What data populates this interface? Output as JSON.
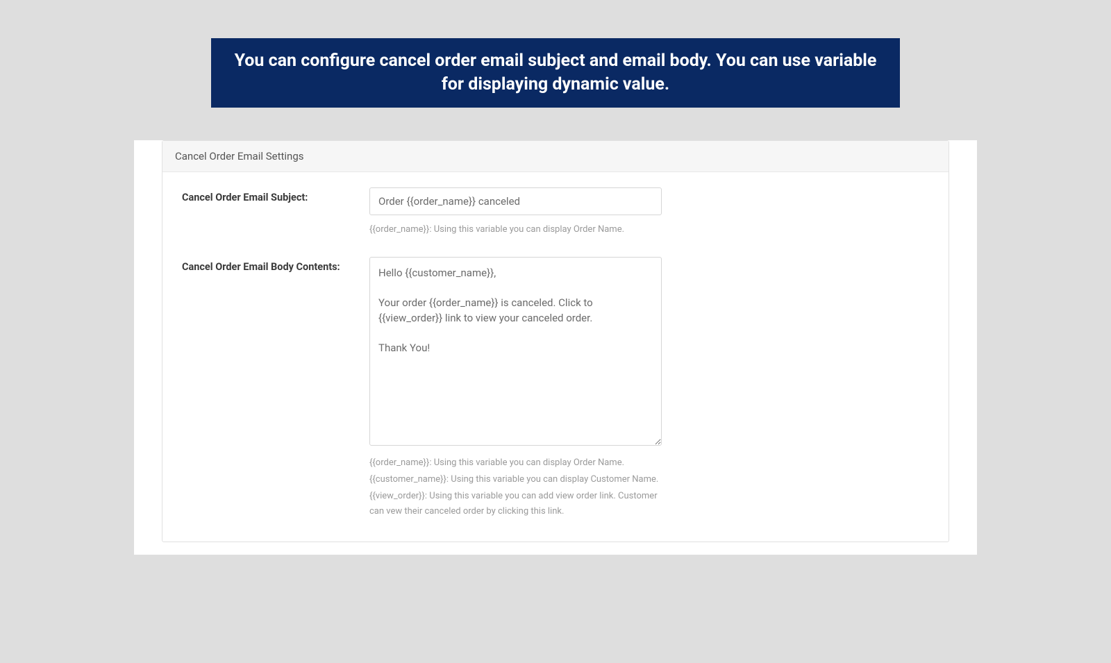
{
  "banner": {
    "text": "You can configure cancel order email subject and email body. You can use variable for displaying dynamic value."
  },
  "panel": {
    "title": "Cancel Order Email Settings",
    "subject": {
      "label": "Cancel Order Email Subject:",
      "value": "Order {{order_name}} canceled",
      "hint": "{{order_name}}: Using this variable you can display Order Name."
    },
    "body": {
      "label": "Cancel Order Email Body Contents:",
      "value": "Hello {{customer_name}},\n\nYour order {{order_name}} is canceled. Click to {{view_order}} link to view your canceled order.\n\nThank You!",
      "hints": [
        "{{order_name}}: Using this variable you can display Order Name.",
        "{{customer_name}}: Using this variable you can display Customer Name.",
        "{{view_order}}: Using this variable you can add view order link. Customer can vew their canceled order by clicking this link."
      ]
    }
  }
}
